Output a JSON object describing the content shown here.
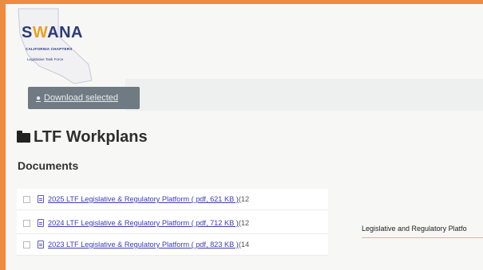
{
  "logo": {
    "wordmark_left": "S",
    "wordmark_accent": "W",
    "wordmark_right": "ANA",
    "chapter": "CALIFORNIA CHAPTERS",
    "taskforce": "Legislative Task Force"
  },
  "toolbar": {
    "download_label": "Download selected",
    "download_icon": "download-icon"
  },
  "section": {
    "title": "LTF Workplans",
    "subtitle": "Documents"
  },
  "documents": [
    {
      "link": "2025 LTF Legislative & Regulatory Platform ( pdf, 621 KB )",
      "suffix": "(12"
    },
    {
      "link": "2024 LTF Legislative & Regulatory Platform ( pdf, 712 KB )",
      "suffix": "(12"
    },
    {
      "link": "2023 LTF Legislative & Regulatory Platform ( pdf, 823 KB )",
      "suffix": "(14"
    }
  ],
  "preview": {
    "label": "Legislative and Regulatory Platfo"
  }
}
